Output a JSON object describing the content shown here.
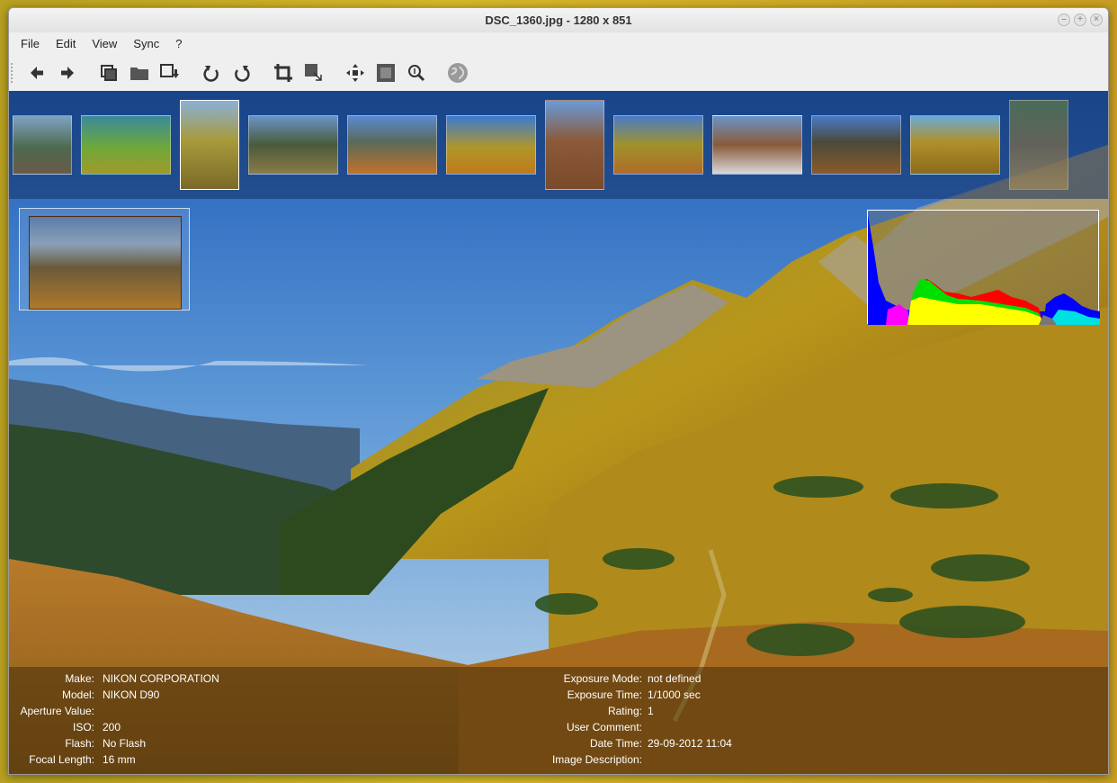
{
  "window": {
    "title": "DSC_1360.jpg - 1280 x 851"
  },
  "menu": [
    "File",
    "Edit",
    "View",
    "Sync",
    "?"
  ],
  "toolbar": {
    "icons": [
      "arrow-left-icon",
      "arrow-right-icon",
      "copy-icon",
      "folder-icon",
      "save-as-icon",
      "rotate-left-icon",
      "rotate-right-icon",
      "crop-icon",
      "resize-icon",
      "fit-icon",
      "fullscreen-icon",
      "zoom-icon",
      "globe-icon"
    ]
  },
  "filmstrip": {
    "thumbnail_count": 12,
    "selected_index": 2
  },
  "exif": {
    "left": [
      {
        "label": "Make:",
        "value": "NIKON CORPORATION"
      },
      {
        "label": "Model:",
        "value": "NIKON D90"
      },
      {
        "label": "Aperture Value:",
        "value": ""
      },
      {
        "label": "ISO:",
        "value": "200"
      },
      {
        "label": "Flash:",
        "value": "No Flash"
      },
      {
        "label": "Focal Length:",
        "value": "16 mm"
      }
    ],
    "right": [
      {
        "label": "Exposure Mode:",
        "value": "not defined"
      },
      {
        "label": "Exposure Time:",
        "value": "1/1000 sec"
      },
      {
        "label": "Rating:",
        "value": "1"
      },
      {
        "label": "User Comment:",
        "value": ""
      },
      {
        "label": "Date Time:",
        "value": "29-09-2012 11:04"
      },
      {
        "label": "Image Description:",
        "value": ""
      }
    ]
  },
  "colors": {
    "accent": "#3d74c9",
    "histogram_red": "#ff0000",
    "histogram_green": "#00e000",
    "histogram_blue": "#0000ff",
    "histogram_yellow": "#ffff00"
  }
}
